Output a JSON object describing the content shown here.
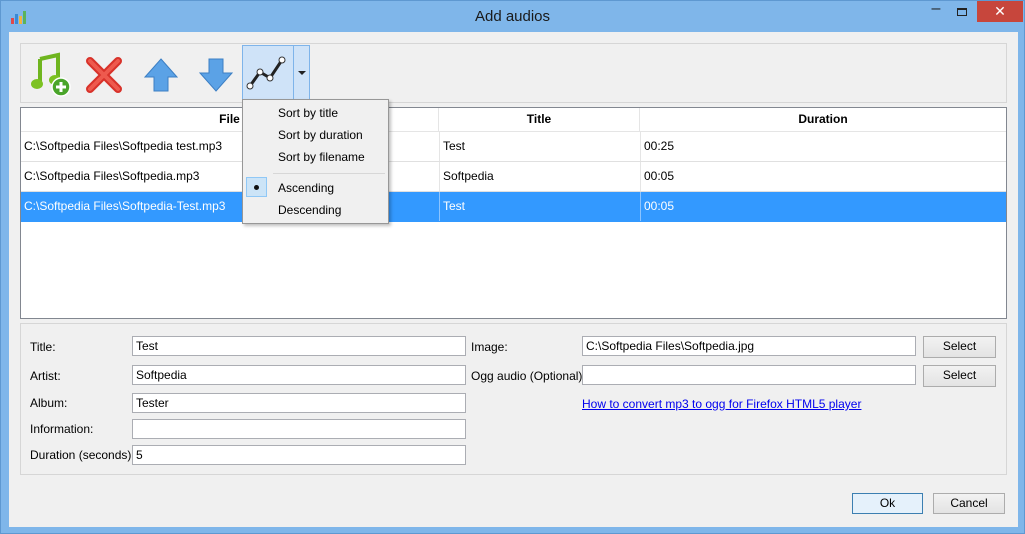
{
  "window": {
    "title": "Add audios",
    "minimize": "–",
    "close": "✕"
  },
  "toolbar": {
    "add_icon": "add-audio-icon",
    "remove_icon": "delete-x-icon",
    "up_icon": "arrow-up-icon",
    "down_icon": "arrow-down-icon",
    "sort_icon": "sort-graph-icon"
  },
  "table": {
    "columns": [
      "File",
      "Title",
      "Duration"
    ],
    "rows": [
      {
        "file": "C:\\Softpedia Files\\Softpedia test.mp3",
        "title": "Test",
        "duration": "00:25"
      },
      {
        "file": "C:\\Softpedia Files\\Softpedia.mp3",
        "title": "Softpedia",
        "duration": "00:05"
      },
      {
        "file": "C:\\Softpedia Files\\Softpedia-Test.mp3",
        "title": "Test",
        "duration": "00:05"
      }
    ]
  },
  "sort_menu": {
    "items": [
      "Sort by title",
      "Sort by duration",
      "Sort by filename",
      "Ascending",
      "Descending"
    ],
    "selected": "Ascending"
  },
  "details": {
    "title_label": "Title:",
    "title_value": "Test",
    "artist_label": "Artist:",
    "artist_value": "Softpedia",
    "album_label": "Album:",
    "album_value": "Tester",
    "information_label": "Information:",
    "information_value": "",
    "duration_label": "Duration (seconds):",
    "duration_value": "5",
    "image_label": "Image:",
    "image_value": "C:\\Softpedia Files\\Softpedia.jpg",
    "ogg_label": "Ogg audio (Optional):",
    "ogg_value": "",
    "select_label": "Select",
    "convert_link": "How to convert mp3 to ogg for Firefox HTML5 player"
  },
  "buttons": {
    "ok": "Ok",
    "cancel": "Cancel"
  },
  "colors": {
    "accent": "#3399ff",
    "titlebar": "#7fb6ea",
    "close": "#c7463c"
  }
}
